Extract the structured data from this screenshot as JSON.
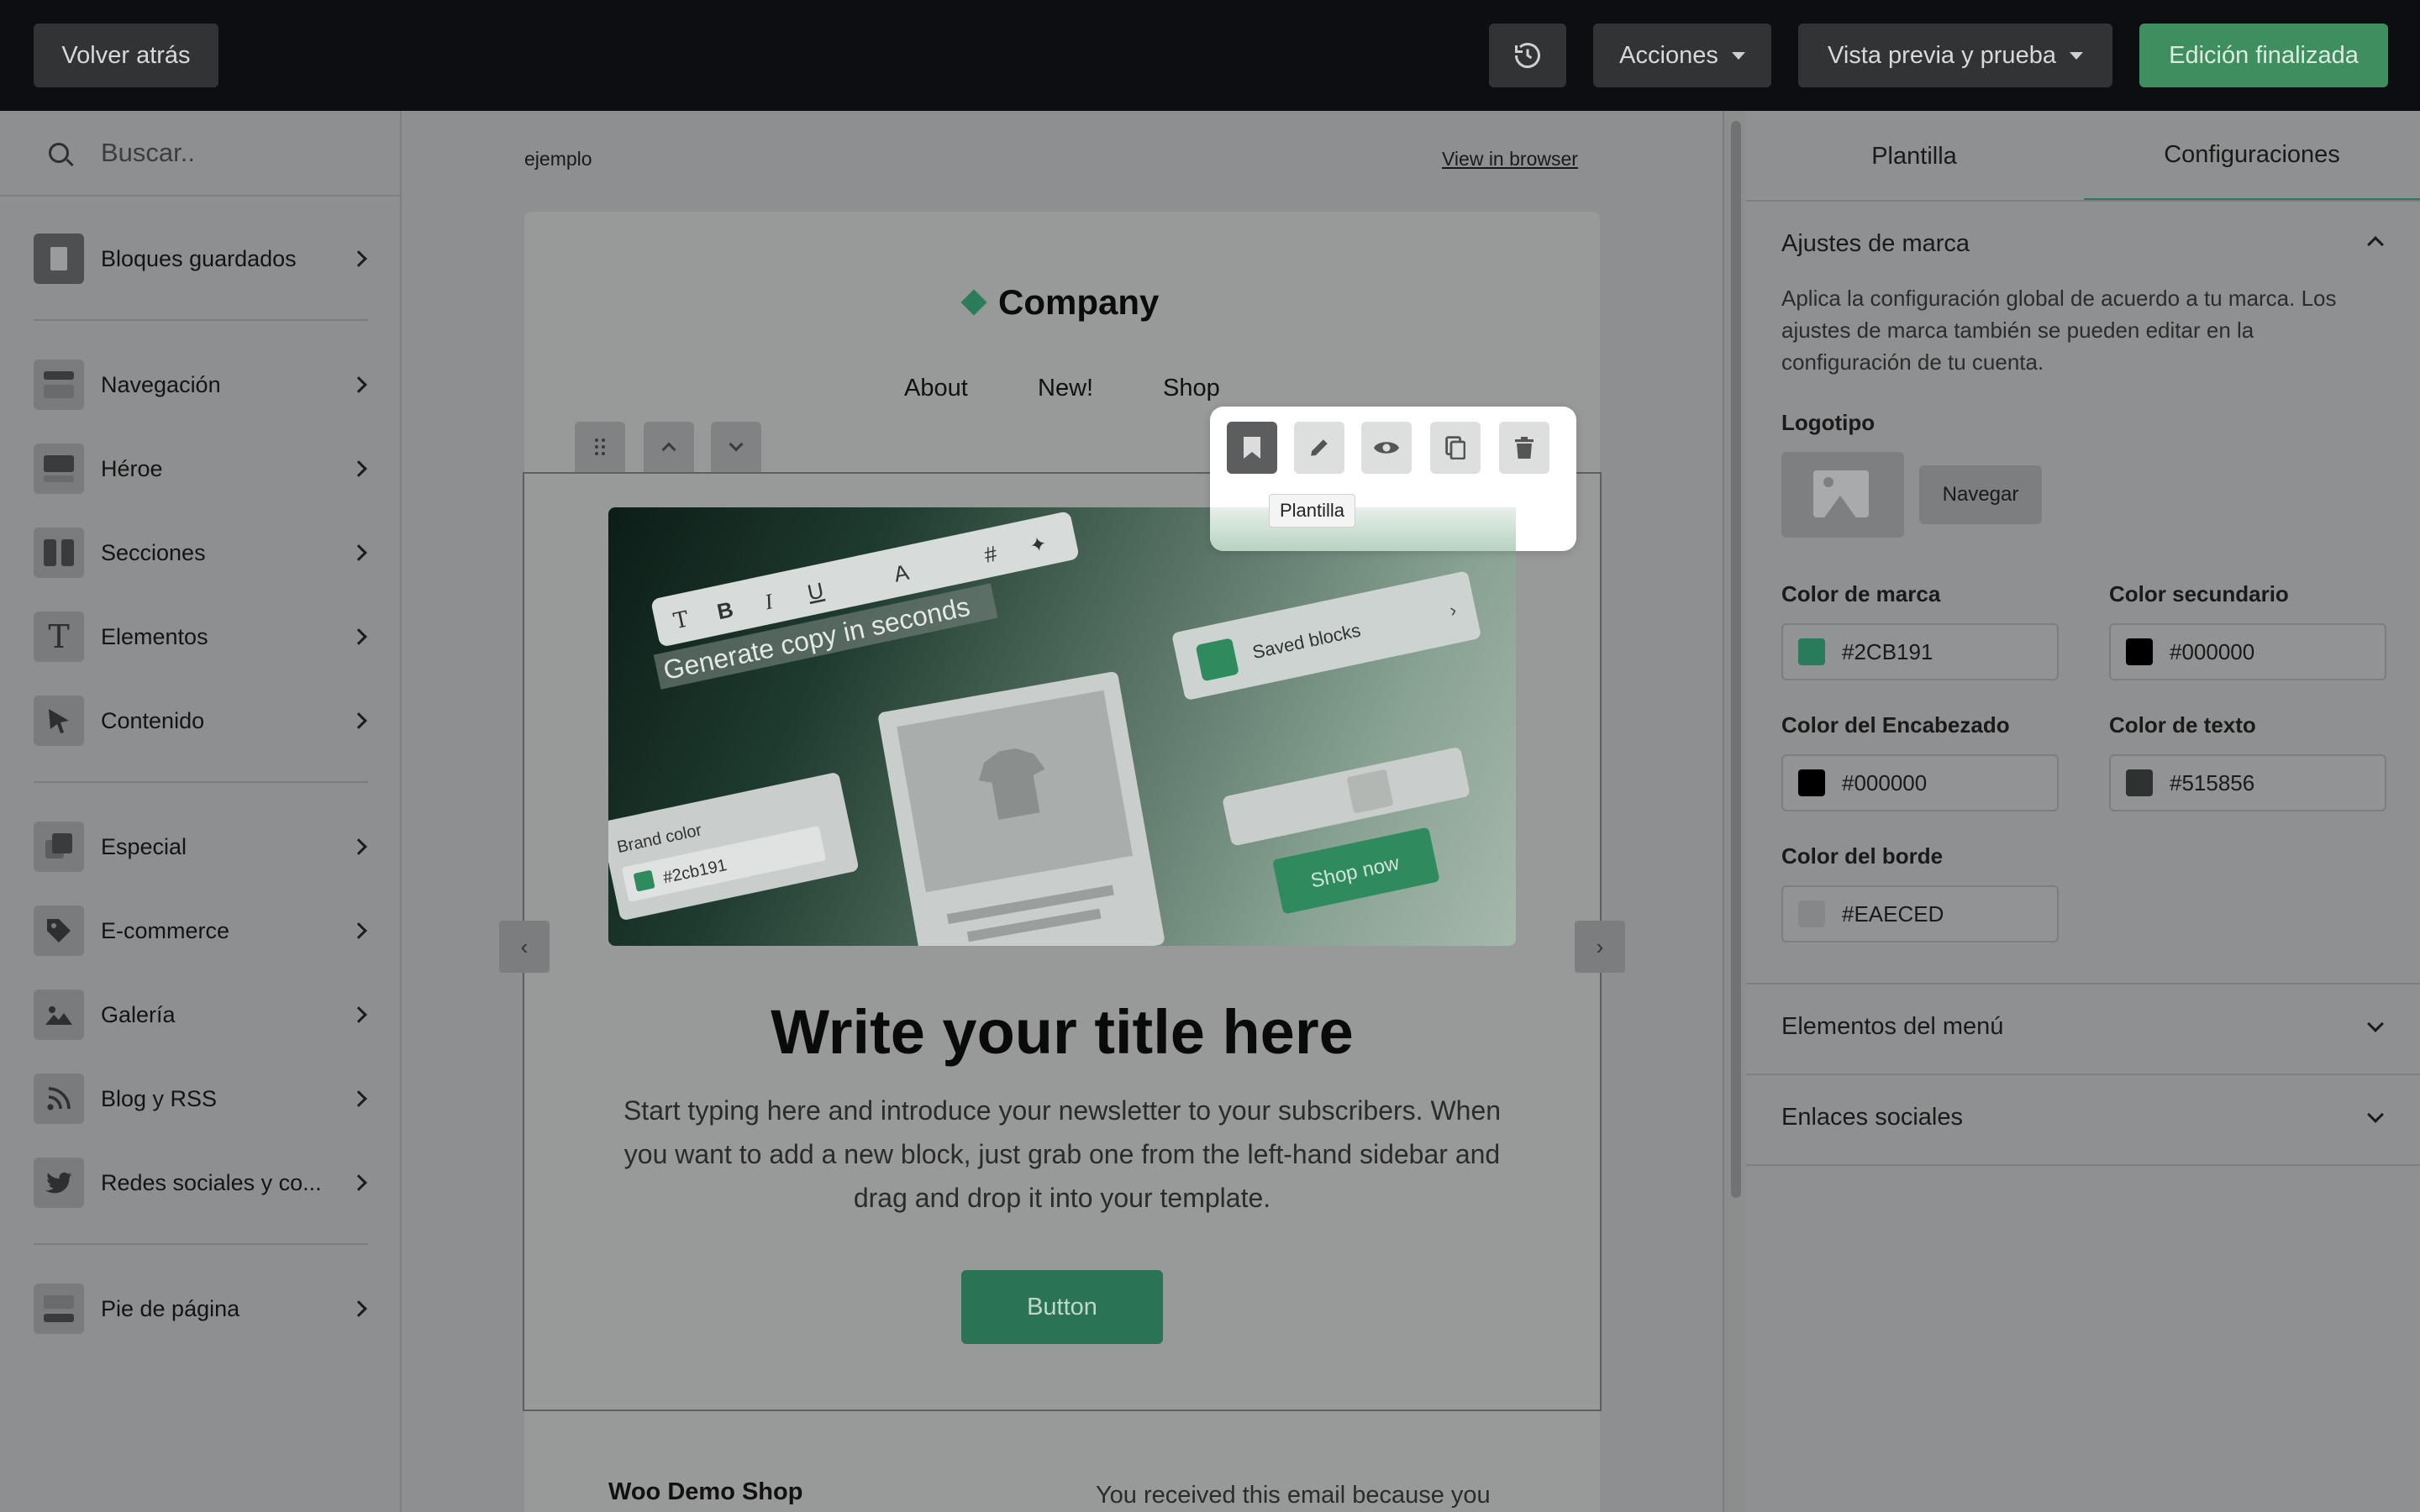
{
  "topbar": {
    "back_label": "Volver atrás",
    "actions_label": "Acciones",
    "preview_label": "Vista previa y prueba",
    "done_label": "Edición finalizada"
  },
  "sidebar": {
    "search_placeholder": "Buscar..",
    "items": [
      {
        "label": "Bloques guardados",
        "icon": "bookmark-icon"
      },
      {
        "label": "Navegación",
        "icon": "navigation-block-icon"
      },
      {
        "label": "Héroe",
        "icon": "hero-block-icon"
      },
      {
        "label": "Secciones",
        "icon": "columns-icon"
      },
      {
        "label": "Elementos",
        "icon": "text-t-icon"
      },
      {
        "label": "Contenido",
        "icon": "cursor-icon"
      },
      {
        "label": "Especial",
        "icon": "layers-icon"
      },
      {
        "label": "E-commerce",
        "icon": "tag-icon"
      },
      {
        "label": "Galería",
        "icon": "image-icon"
      },
      {
        "label": "Blog y RSS",
        "icon": "rss-icon"
      },
      {
        "label": "Redes sociales y co...",
        "icon": "twitter-icon"
      },
      {
        "label": "Pie de página",
        "icon": "footer-block-icon"
      }
    ]
  },
  "email": {
    "preheader": "ejemplo",
    "view_in_browser": "View in browser",
    "company": "Company",
    "nav": [
      "About",
      "New!",
      "Shop"
    ],
    "tooltip": "Plantilla",
    "hero_image": {
      "headline": "Generate copy in seconds",
      "saved_blocks": "Saved blocks",
      "brand_color_label": "Brand color",
      "brand_color_value": "#2cb191",
      "shop_now": "Shop now"
    },
    "title": "Write your title here",
    "body": "Start typing here and introduce your newsletter to your subscribers. When you want to add a new block, just grab one from the left-hand sidebar and drag and drop it into your template.",
    "button": "Button",
    "footer_shop": "Woo Demo Shop",
    "footer_note": "You received this email because you"
  },
  "panel": {
    "tab_template": "Plantilla",
    "tab_settings": "Configuraciones",
    "brand_settings_title": "Ajustes de marca",
    "brand_settings_desc": "Aplica la configuración global de acuerdo a tu marca. Los ajustes de marca también se pueden editar en la configuración de tu cuenta.",
    "logo_label": "Logotipo",
    "browse_label": "Navegar",
    "colors": {
      "brand": {
        "label": "Color de marca",
        "value": "#2CB191"
      },
      "secondary": {
        "label": "Color secundario",
        "value": "#000000"
      },
      "heading": {
        "label": "Color del Encabezado",
        "value": "#000000"
      },
      "text": {
        "label": "Color de texto",
        "value": "#515856"
      },
      "border": {
        "label": "Color del borde",
        "value": "#EAECED"
      }
    },
    "menu_items_title": "Elementos del menú",
    "social_links_title": "Enlaces sociales"
  },
  "colors": {
    "accent": "#3e8e5f",
    "brand_swatch": "#2CB191"
  }
}
